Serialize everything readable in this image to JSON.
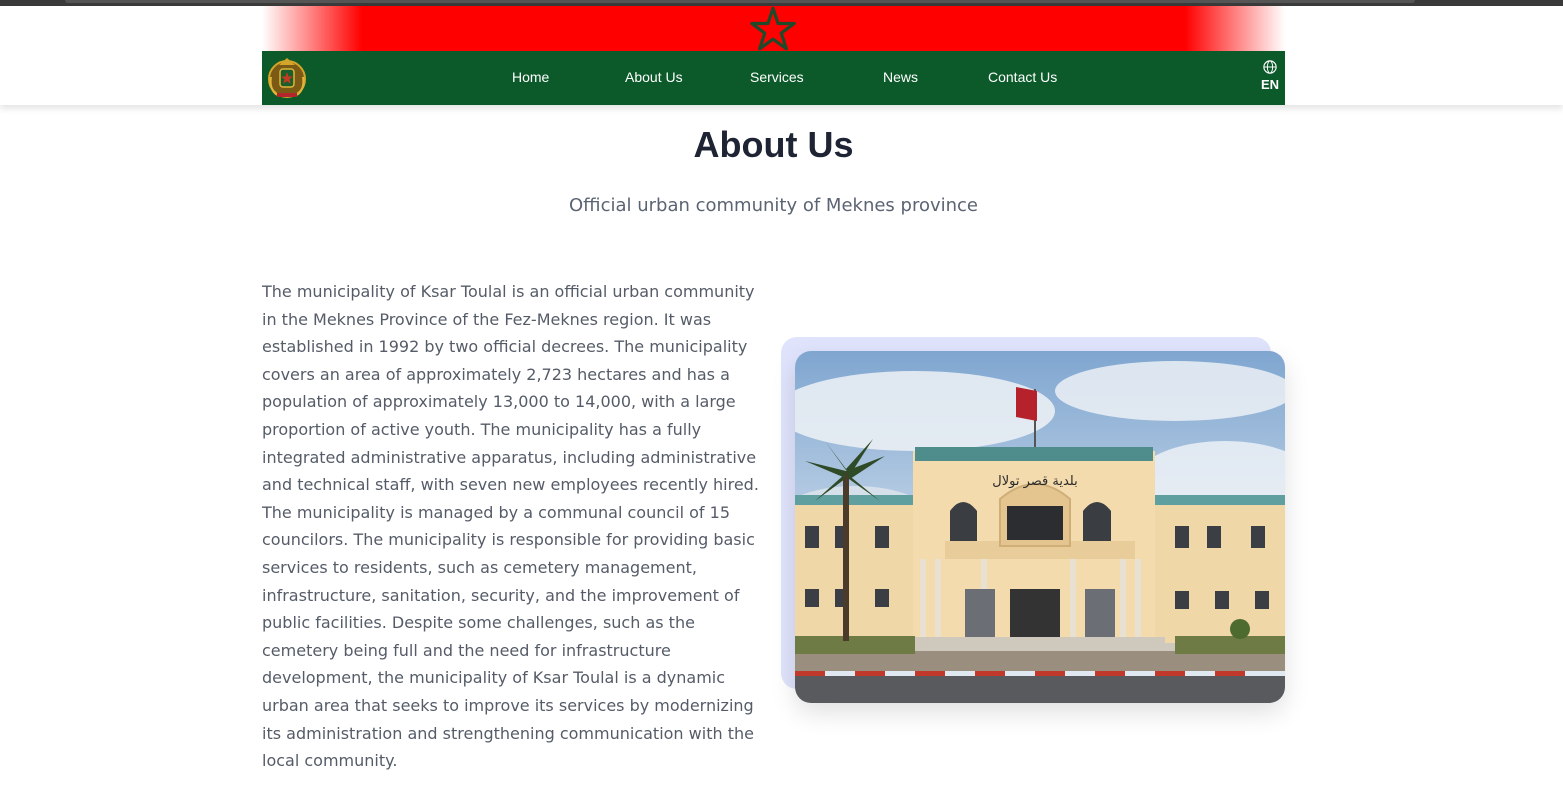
{
  "nav": {
    "items": [
      {
        "label": "Home"
      },
      {
        "label": "About Us"
      },
      {
        "label": "Services"
      },
      {
        "label": "News"
      },
      {
        "label": "Contact Us"
      }
    ],
    "language": "EN",
    "language_icon": "globe-icon",
    "logo_icon": "royal-emblem-icon",
    "flag_icon": "star-icon"
  },
  "colors": {
    "flag_red": "#ff0000",
    "nav_green": "#0c5a2a",
    "title": "#1e2433",
    "text": "#555c68",
    "accent_backdrop": "#dfe3fb"
  },
  "about": {
    "title": "About Us",
    "subtitle": "Official urban community of Meknes province",
    "body": "The municipality of Ksar Toulal is an official urban community in the Meknes Province of the Fez-Meknes region. It was established in 1992 by two official decrees. The municipality covers an area of approximately 2,723 hectares and has a population of approximately 13,000 to 14,000, with a large proportion of active youth. The municipality has a fully integrated administrative apparatus, including administrative and technical staff, with seven new employees recently hired. The municipality is managed by a communal council of 15 councilors. The municipality is responsible for providing basic services to residents, such as cemetery management, infrastructure, sanitation, security, and the improvement of public facilities. Despite some challenges, such as the cemetery being full and the need for infrastructure development, the municipality of Ksar Toulal is a dynamic urban area that seeks to improve its services by modernizing its administration and strengthening communication with the local community.",
    "building_sign": "بلدية قصر تولال"
  }
}
